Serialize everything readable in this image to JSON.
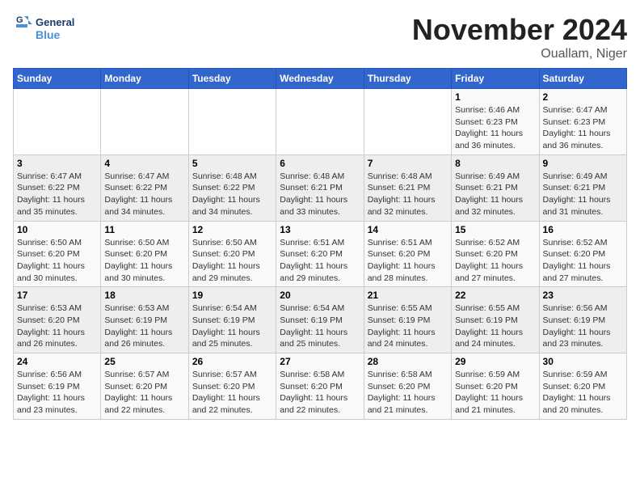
{
  "logo": {
    "line1": "General",
    "line2": "Blue"
  },
  "title": "November 2024",
  "location": "Ouallam, Niger",
  "days_header": [
    "Sunday",
    "Monday",
    "Tuesday",
    "Wednesday",
    "Thursday",
    "Friday",
    "Saturday"
  ],
  "weeks": [
    [
      {
        "day": "",
        "info": ""
      },
      {
        "day": "",
        "info": ""
      },
      {
        "day": "",
        "info": ""
      },
      {
        "day": "",
        "info": ""
      },
      {
        "day": "",
        "info": ""
      },
      {
        "day": "1",
        "info": "Sunrise: 6:46 AM\nSunset: 6:23 PM\nDaylight: 11 hours and 36 minutes."
      },
      {
        "day": "2",
        "info": "Sunrise: 6:47 AM\nSunset: 6:23 PM\nDaylight: 11 hours and 36 minutes."
      }
    ],
    [
      {
        "day": "3",
        "info": "Sunrise: 6:47 AM\nSunset: 6:22 PM\nDaylight: 11 hours and 35 minutes."
      },
      {
        "day": "4",
        "info": "Sunrise: 6:47 AM\nSunset: 6:22 PM\nDaylight: 11 hours and 34 minutes."
      },
      {
        "day": "5",
        "info": "Sunrise: 6:48 AM\nSunset: 6:22 PM\nDaylight: 11 hours and 34 minutes."
      },
      {
        "day": "6",
        "info": "Sunrise: 6:48 AM\nSunset: 6:21 PM\nDaylight: 11 hours and 33 minutes."
      },
      {
        "day": "7",
        "info": "Sunrise: 6:48 AM\nSunset: 6:21 PM\nDaylight: 11 hours and 32 minutes."
      },
      {
        "day": "8",
        "info": "Sunrise: 6:49 AM\nSunset: 6:21 PM\nDaylight: 11 hours and 32 minutes."
      },
      {
        "day": "9",
        "info": "Sunrise: 6:49 AM\nSunset: 6:21 PM\nDaylight: 11 hours and 31 minutes."
      }
    ],
    [
      {
        "day": "10",
        "info": "Sunrise: 6:50 AM\nSunset: 6:20 PM\nDaylight: 11 hours and 30 minutes."
      },
      {
        "day": "11",
        "info": "Sunrise: 6:50 AM\nSunset: 6:20 PM\nDaylight: 11 hours and 30 minutes."
      },
      {
        "day": "12",
        "info": "Sunrise: 6:50 AM\nSunset: 6:20 PM\nDaylight: 11 hours and 29 minutes."
      },
      {
        "day": "13",
        "info": "Sunrise: 6:51 AM\nSunset: 6:20 PM\nDaylight: 11 hours and 29 minutes."
      },
      {
        "day": "14",
        "info": "Sunrise: 6:51 AM\nSunset: 6:20 PM\nDaylight: 11 hours and 28 minutes."
      },
      {
        "day": "15",
        "info": "Sunrise: 6:52 AM\nSunset: 6:20 PM\nDaylight: 11 hours and 27 minutes."
      },
      {
        "day": "16",
        "info": "Sunrise: 6:52 AM\nSunset: 6:20 PM\nDaylight: 11 hours and 27 minutes."
      }
    ],
    [
      {
        "day": "17",
        "info": "Sunrise: 6:53 AM\nSunset: 6:20 PM\nDaylight: 11 hours and 26 minutes."
      },
      {
        "day": "18",
        "info": "Sunrise: 6:53 AM\nSunset: 6:19 PM\nDaylight: 11 hours and 26 minutes."
      },
      {
        "day": "19",
        "info": "Sunrise: 6:54 AM\nSunset: 6:19 PM\nDaylight: 11 hours and 25 minutes."
      },
      {
        "day": "20",
        "info": "Sunrise: 6:54 AM\nSunset: 6:19 PM\nDaylight: 11 hours and 25 minutes."
      },
      {
        "day": "21",
        "info": "Sunrise: 6:55 AM\nSunset: 6:19 PM\nDaylight: 11 hours and 24 minutes."
      },
      {
        "day": "22",
        "info": "Sunrise: 6:55 AM\nSunset: 6:19 PM\nDaylight: 11 hours and 24 minutes."
      },
      {
        "day": "23",
        "info": "Sunrise: 6:56 AM\nSunset: 6:19 PM\nDaylight: 11 hours and 23 minutes."
      }
    ],
    [
      {
        "day": "24",
        "info": "Sunrise: 6:56 AM\nSunset: 6:19 PM\nDaylight: 11 hours and 23 minutes."
      },
      {
        "day": "25",
        "info": "Sunrise: 6:57 AM\nSunset: 6:20 PM\nDaylight: 11 hours and 22 minutes."
      },
      {
        "day": "26",
        "info": "Sunrise: 6:57 AM\nSunset: 6:20 PM\nDaylight: 11 hours and 22 minutes."
      },
      {
        "day": "27",
        "info": "Sunrise: 6:58 AM\nSunset: 6:20 PM\nDaylight: 11 hours and 22 minutes."
      },
      {
        "day": "28",
        "info": "Sunrise: 6:58 AM\nSunset: 6:20 PM\nDaylight: 11 hours and 21 minutes."
      },
      {
        "day": "29",
        "info": "Sunrise: 6:59 AM\nSunset: 6:20 PM\nDaylight: 11 hours and 21 minutes."
      },
      {
        "day": "30",
        "info": "Sunrise: 6:59 AM\nSunset: 6:20 PM\nDaylight: 11 hours and 20 minutes."
      }
    ]
  ]
}
